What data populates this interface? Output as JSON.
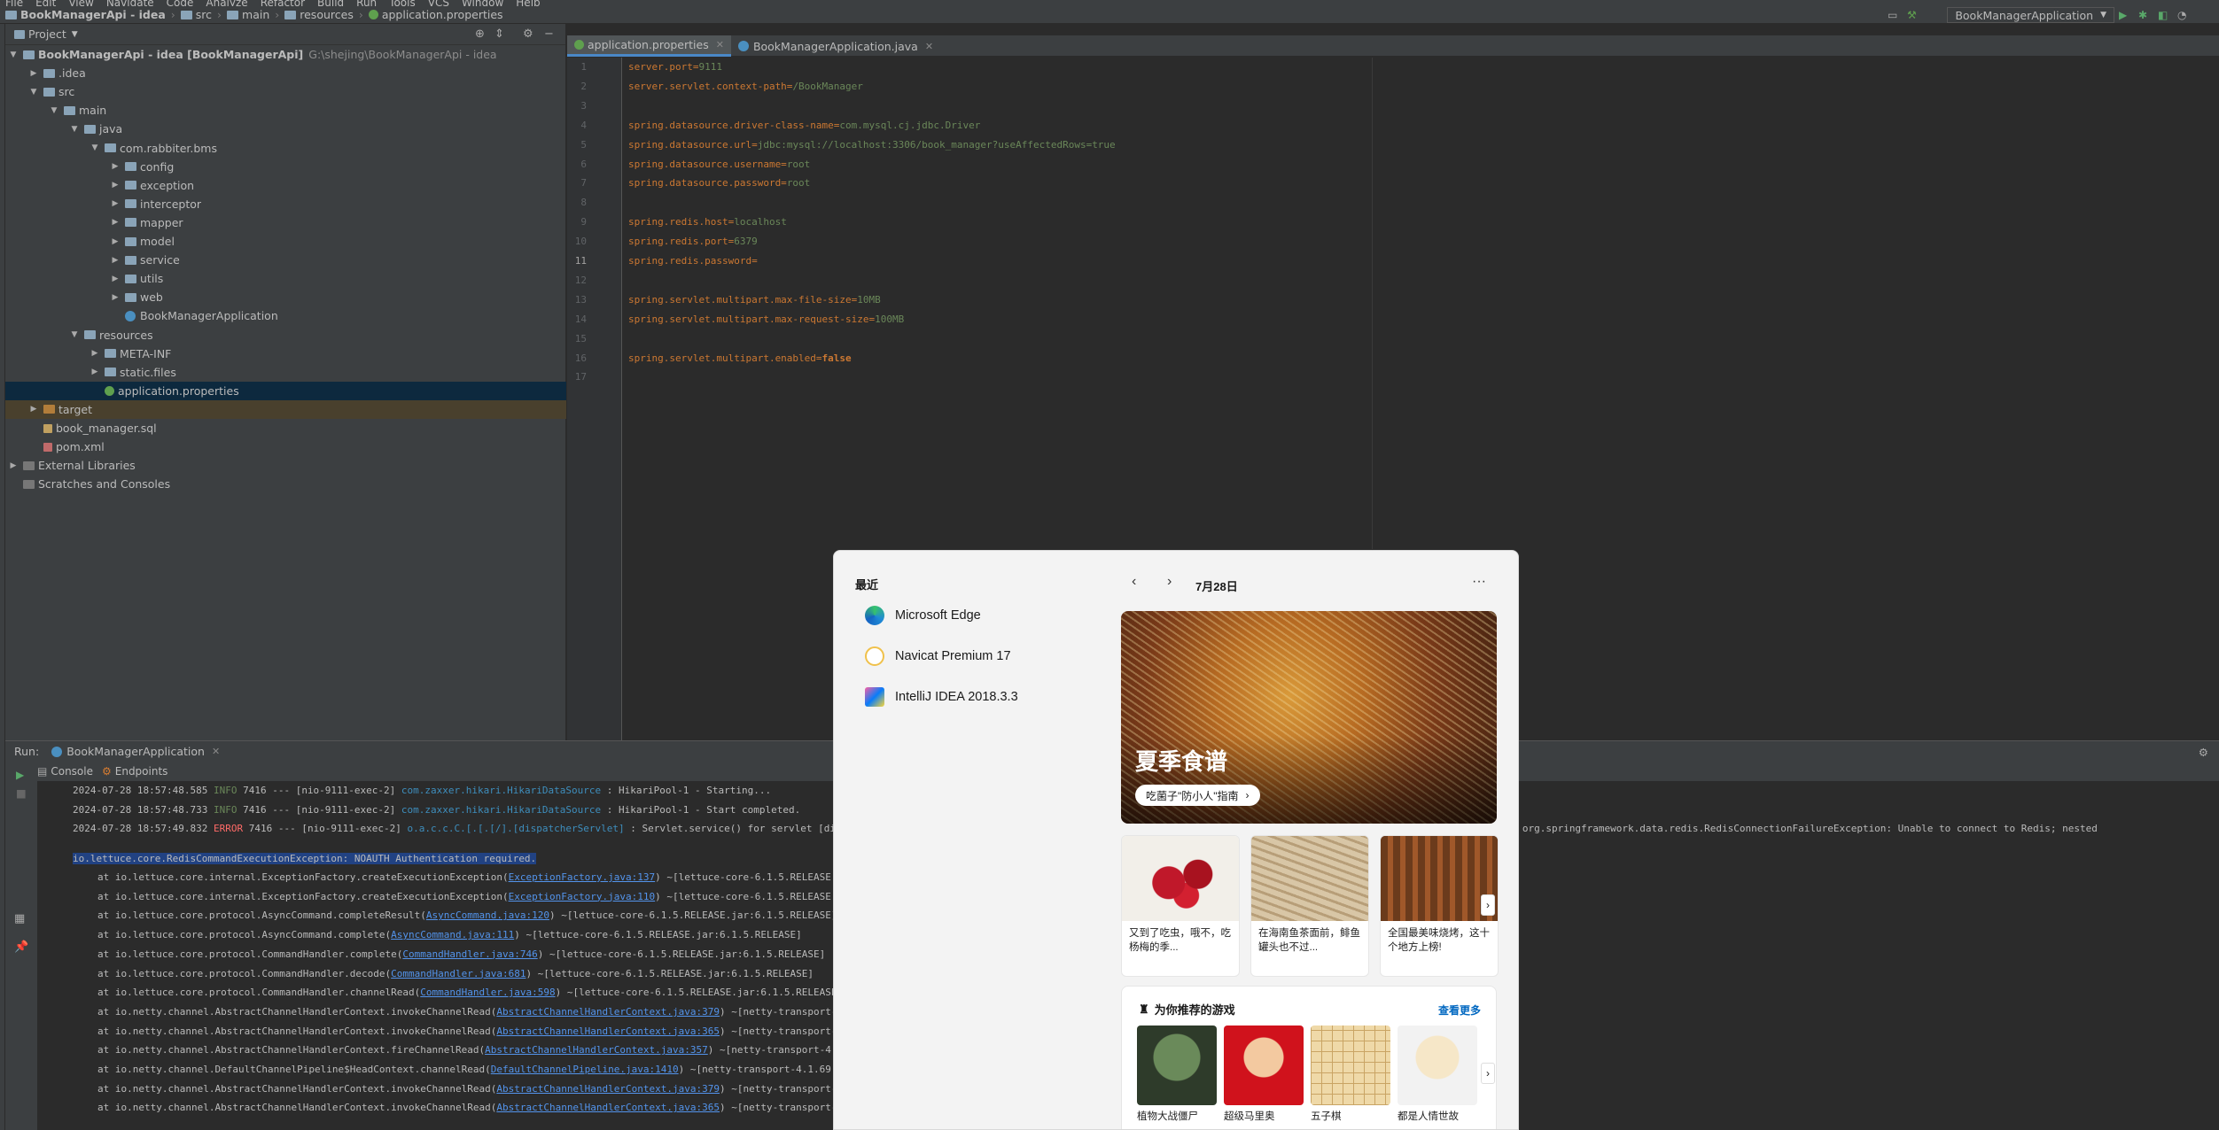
{
  "menubar": {
    "items": [
      "File",
      "Edit",
      "View",
      "Navigate",
      "Code",
      "Analyze",
      "Refactor",
      "Build",
      "Run",
      "Tools",
      "VCS",
      "Window",
      "Help"
    ]
  },
  "navbar": {
    "project": "BookManagerApi - idea",
    "crumbs": [
      "BookManagerApi - idea",
      "src",
      "main",
      "resources",
      "application.properties"
    ],
    "run_config": "BookManagerApplication"
  },
  "project_panel": {
    "title": "Project",
    "tree": [
      {
        "label": "BookManagerApi - idea [BookManagerApi]",
        "extra": "G:\\shejing\\BookManagerApi - idea",
        "depth": 0,
        "open": true,
        "icon": "module-folder-icon"
      },
      {
        "label": ".idea",
        "depth": 1,
        "open": false,
        "icon": "folder-icon"
      },
      {
        "label": "src",
        "depth": 1,
        "open": true,
        "icon": "folder-icon"
      },
      {
        "label": "main",
        "depth": 2,
        "open": true,
        "icon": "folder-icon"
      },
      {
        "label": "java",
        "depth": 3,
        "open": true,
        "icon": "source-folder-icon"
      },
      {
        "label": "com.rabbiter.bms",
        "depth": 4,
        "open": true,
        "icon": "package-icon"
      },
      {
        "label": "config",
        "depth": 5,
        "open": false,
        "icon": "package-icon"
      },
      {
        "label": "exception",
        "depth": 5,
        "open": false,
        "icon": "package-icon"
      },
      {
        "label": "interceptor",
        "depth": 5,
        "open": false,
        "icon": "package-icon"
      },
      {
        "label": "mapper",
        "depth": 5,
        "open": false,
        "icon": "package-icon"
      },
      {
        "label": "model",
        "depth": 5,
        "open": false,
        "icon": "package-icon"
      },
      {
        "label": "service",
        "depth": 5,
        "open": false,
        "icon": "package-icon"
      },
      {
        "label": "utils",
        "depth": 5,
        "open": false,
        "icon": "package-icon"
      },
      {
        "label": "web",
        "depth": 5,
        "open": false,
        "icon": "package-icon"
      },
      {
        "label": "BookManagerApplication",
        "depth": 5,
        "leaf": true,
        "icon": "spring-class-icon"
      },
      {
        "label": "resources",
        "depth": 3,
        "open": true,
        "icon": "resources-folder-icon"
      },
      {
        "label": "META-INF",
        "depth": 4,
        "open": false,
        "icon": "folder-icon"
      },
      {
        "label": "static.files",
        "depth": 4,
        "open": false,
        "icon": "folder-icon"
      },
      {
        "label": "application.properties",
        "depth": 4,
        "leaf": true,
        "icon": "properties-file-icon",
        "selected": true
      },
      {
        "label": "target",
        "depth": 1,
        "open": false,
        "icon": "excluded-folder-icon",
        "excluded": true
      },
      {
        "label": "book_manager.sql",
        "depth": 1,
        "leaf": true,
        "icon": "sql-file-icon"
      },
      {
        "label": "pom.xml",
        "depth": 1,
        "leaf": true,
        "icon": "maven-file-icon"
      },
      {
        "label": "External Libraries",
        "depth": 0,
        "open": false,
        "icon": "libraries-icon"
      },
      {
        "label": "Scratches and Consoles",
        "depth": 0,
        "leaf": true,
        "icon": "scratches-icon"
      }
    ]
  },
  "editor": {
    "tabs": [
      {
        "label": "application.properties",
        "active": true
      },
      {
        "label": "BookManagerApplication.java",
        "active": false
      }
    ],
    "current_line": 11,
    "lines": [
      {
        "n": "1",
        "key": "server.port=",
        "val": "9111"
      },
      {
        "n": "2",
        "key": "server.servlet.context-path=",
        "val": "/BookManager"
      },
      {
        "n": "3",
        "key": "",
        "val": ""
      },
      {
        "n": "4",
        "key": "spring.datasource.driver-class-name=",
        "val": "com.mysql.cj.jdbc.Driver"
      },
      {
        "n": "5",
        "key": "spring.datasource.url=",
        "val": "jdbc:mysql://localhost:3306/book_manager?useAffectedRows=true"
      },
      {
        "n": "6",
        "key": "spring.datasource.username=",
        "val": "root"
      },
      {
        "n": "7",
        "key": "spring.datasource.password=",
        "val": "root"
      },
      {
        "n": "8",
        "key": "",
        "val": ""
      },
      {
        "n": "9",
        "key": "spring.redis.host=",
        "val": "localhost"
      },
      {
        "n": "10",
        "key": "spring.redis.port=",
        "val": "6379"
      },
      {
        "n": "11",
        "key": "spring.redis.password=",
        "val": ""
      },
      {
        "n": "12",
        "key": "",
        "val": ""
      },
      {
        "n": "13",
        "key": "spring.servlet.multipart.max-file-size=",
        "val": "10MB"
      },
      {
        "n": "14",
        "key": "spring.servlet.multipart.max-request-size=",
        "val": "100MB"
      },
      {
        "n": "15",
        "key": "",
        "val": ""
      },
      {
        "n": "16",
        "key": "spring.servlet.multipart.enabled=",
        "val": "false",
        "bold": true
      },
      {
        "n": "17",
        "key": "",
        "val": ""
      }
    ]
  },
  "run_panel": {
    "label": "Run:",
    "config": "BookManagerApplication",
    "tabs": [
      "Console",
      "Endpoints"
    ],
    "log_lines": [
      {
        "time": "2024-07-28 18:57:48.585",
        "level": "INFO",
        "pid": "7416",
        "thread": "--- [nio-9111-exec-2]",
        "cls": "com.zaxxer.hikari.HikariDataSource",
        "msg": ": HikariPool-1 - Starting..."
      },
      {
        "time": "2024-07-28 18:57:48.733",
        "level": "INFO",
        "pid": "7416",
        "thread": "--- [nio-9111-exec-2]",
        "cls": "com.zaxxer.hikari.HikariDataSource",
        "msg": ": HikariPool-1 - Start completed."
      },
      {
        "time": "2024-07-28 18:57:49.832",
        "level": "ERROR",
        "pid": "7416",
        "thread": "--- [nio-9111-exec-2]",
        "cls": "o.a.c.c.C.[.[.[/].[dispatcherServlet]",
        "msg": ": Servlet.service() for servlet [dispatcherServlet] in context with path [/BookManager] threw exception [Request processing failed; nested exception is org.springframework.data.redis.RedisConnectionFailureException: Unable to connect to Redis; nested"
      }
    ],
    "exception_head": "io.lettuce.core.RedisCommandExecutionException: NOAUTH Authentication required.",
    "stack": [
      {
        "pre": "at io.lettuce.core.internal.ExceptionFactory.createExecutionException(",
        "link": "ExceptionFactory.java:137",
        "post": ") ~[lettuce-core-6.1.5.RELEASE.jar:6.1.5.RELEASE]"
      },
      {
        "pre": "at io.lettuce.core.internal.ExceptionFactory.createExecutionException(",
        "link": "ExceptionFactory.java:110",
        "post": ") ~[lettuce-core-6.1.5.RELEASE.jar:6.1.5.RELEASE]"
      },
      {
        "pre": "at io.lettuce.core.protocol.AsyncCommand.completeResult(",
        "link": "AsyncCommand.java:120",
        "post": ") ~[lettuce-core-6.1.5.RELEASE.jar:6.1.5.RELEASE]"
      },
      {
        "pre": "at io.lettuce.core.protocol.AsyncCommand.complete(",
        "link": "AsyncCommand.java:111",
        "post": ") ~[lettuce-core-6.1.5.RELEASE.jar:6.1.5.RELEASE]"
      },
      {
        "pre": "at io.lettuce.core.protocol.CommandHandler.complete(",
        "link": "CommandHandler.java:746",
        "post": ") ~[lettuce-core-6.1.5.RELEASE.jar:6.1.5.RELEASE]"
      },
      {
        "pre": "at io.lettuce.core.protocol.CommandHandler.decode(",
        "link": "CommandHandler.java:681",
        "post": ") ~[lettuce-core-6.1.5.RELEASE.jar:6.1.5.RELEASE]"
      },
      {
        "pre": "at io.lettuce.core.protocol.CommandHandler.channelRead(",
        "link": "CommandHandler.java:598",
        "post": ") ~[lettuce-core-6.1.5.RELEASE.jar:6.1.5.RELEASE]"
      },
      {
        "pre": "at io.netty.channel.AbstractChannelHandlerContext.invokeChannelRead(",
        "link": "AbstractChannelHandlerContext.java:379",
        "post": ") ~[netty-transport-4.1.69.Final.jar:4.1.69.Final]"
      },
      {
        "pre": "at io.netty.channel.AbstractChannelHandlerContext.invokeChannelRead(",
        "link": "AbstractChannelHandlerContext.java:365",
        "post": ") ~[netty-transport-4.1.69.Final.jar:4.1.69.Final]"
      },
      {
        "pre": "at io.netty.channel.AbstractChannelHandlerContext.fireChannelRead(",
        "link": "AbstractChannelHandlerContext.java:357",
        "post": ") ~[netty-transport-4.1.69.Final.jar:4.1.69.Final]"
      },
      {
        "pre": "at io.netty.channel.DefaultChannelPipeline$HeadContext.channelRead(",
        "link": "DefaultChannelPipeline.java:1410",
        "post": ") ~[netty-transport-4.1.69.Final.jar:4.1.69.Final]"
      },
      {
        "pre": "at io.netty.channel.AbstractChannelHandlerContext.invokeChannelRead(",
        "link": "AbstractChannelHandlerContext.java:379",
        "post": ") ~[netty-transport-4.1.69.Final.jar:4.1.69.Final]"
      },
      {
        "pre": "at io.netty.channel.AbstractChannelHandlerContext.invokeChannelRead(",
        "link": "AbstractChannelHandlerContext.java:365",
        "post": ") ~[netty-transport-4.1.69.Final.jar:4.1.69.Final]"
      }
    ]
  },
  "start_menu": {
    "recent_title": "最近",
    "recent": [
      {
        "label": "Microsoft Edge",
        "color": "#1f8ad6"
      },
      {
        "label": "Navicat Premium 17",
        "color": "#f0c14b"
      },
      {
        "label": "IntelliJ IDEA 2018.3.3",
        "color": "#000000"
      }
    ],
    "date": "7月28日",
    "hero": {
      "title": "夏季食谱",
      "pill": "吃菌子\"防小人\"指南"
    },
    "cards": [
      {
        "caption": "又到了吃虫，哦不，吃杨梅的季..."
      },
      {
        "caption": "在海南鱼茶面前，鲱鱼罐头也不过..."
      },
      {
        "caption": "全国最美味烧烤，这十个地方上榜!"
      }
    ],
    "games_title": "为你推荐的游戏",
    "see_more": "查看更多",
    "games": [
      {
        "label": "植物大战僵尸"
      },
      {
        "label": "超级马里奥"
      },
      {
        "label": "五子棋"
      },
      {
        "label": "都是人情世故"
      }
    ],
    "accent": "#0067c0"
  }
}
